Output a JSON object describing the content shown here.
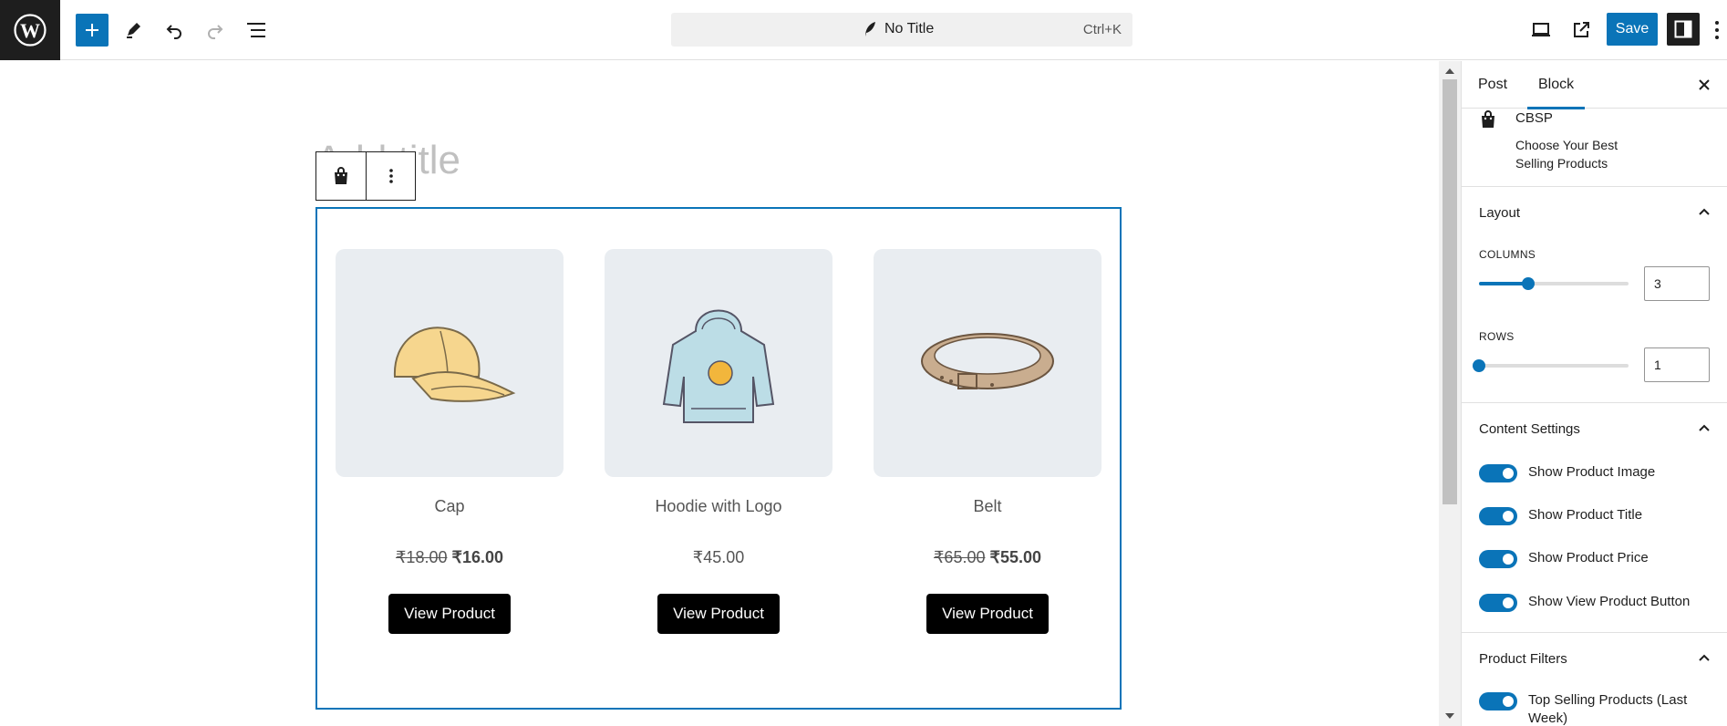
{
  "header": {
    "doc_title": "No Title",
    "shortcut": "Ctrl+K",
    "save_label": "Save"
  },
  "editor": {
    "title_placeholder": "Add title",
    "products": [
      {
        "name": "Cap",
        "regular_price": "₹18.00",
        "sale_price": "₹16.00",
        "button": "View Product",
        "image": "cap-illustration"
      },
      {
        "name": "Hoodie with Logo",
        "regular_price": "",
        "sale_price": "₹45.00",
        "button": "View Product",
        "image": "hoodie-illustration"
      },
      {
        "name": "Belt",
        "regular_price": "₹65.00",
        "sale_price": "₹55.00",
        "button": "View Product",
        "image": "belt-illustration"
      }
    ]
  },
  "sidebar": {
    "tabs": [
      "Post",
      "Block"
    ],
    "active_tab": "Block",
    "block": {
      "title": "CBSP",
      "description": "Choose Your Best Selling Products"
    },
    "layout": {
      "heading": "Layout",
      "columns_label": "COLUMNS",
      "columns_value": "3",
      "columns_fraction": 0.33,
      "rows_label": "ROWS",
      "rows_value": "1",
      "rows_fraction": 0.0
    },
    "content_settings": {
      "heading": "Content Settings",
      "toggles": [
        "Show Product Image",
        "Show Product Title",
        "Show Product Price",
        "Show View Product Button"
      ]
    },
    "product_filters": {
      "heading": "Product Filters",
      "toggles": [
        "Top Selling Products (Last Week)"
      ]
    }
  },
  "colors": {
    "accent": "#0a74b8",
    "dark": "#1e1e1e"
  }
}
